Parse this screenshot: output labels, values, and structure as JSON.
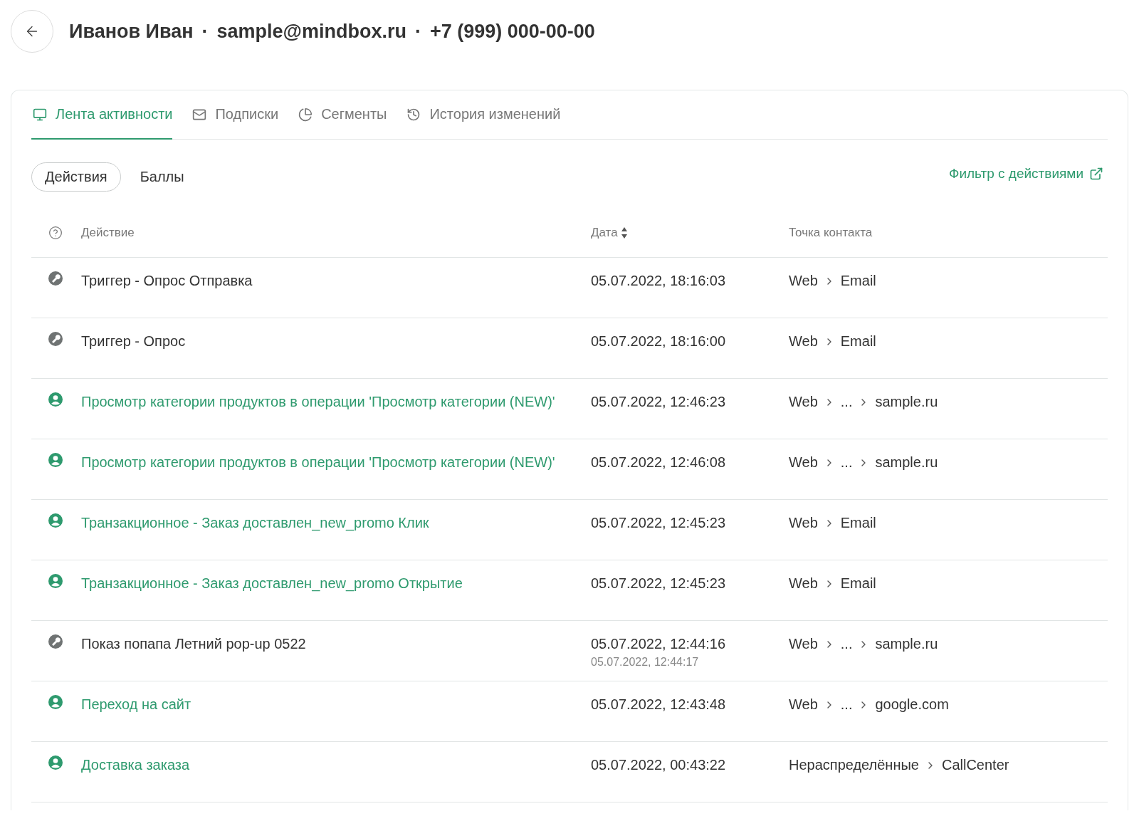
{
  "header": {
    "name": "Иванов Иван",
    "separator_1": "·",
    "email": "sample@mindbox.ru",
    "separator_2": "·",
    "phone": "+7 (999) 000-00-00"
  },
  "tabs": [
    {
      "label": "Лента активности",
      "kind": "feed",
      "selected": true
    },
    {
      "label": "Подписки",
      "kind": "mail",
      "selected": false
    },
    {
      "label": "Сегменты",
      "kind": "pie",
      "selected": false
    },
    {
      "label": "История изменений",
      "kind": "history",
      "selected": false
    }
  ],
  "switcher": [
    {
      "label": "Действия",
      "selected": true
    },
    {
      "label": "Баллы",
      "selected": false
    }
  ],
  "filter_link": "Фильтр с действиями",
  "table": {
    "columns": [
      "Действие",
      "Дата",
      "Точка контакта"
    ],
    "rows": [
      {
        "kind": "system",
        "action": "Триггер - Опрос Отправка",
        "date": "05.07.2022, 18:16:03",
        "contact": [
          "Web",
          "Email"
        ]
      },
      {
        "kind": "system",
        "action": "Триггер - Опрос",
        "date": "05.07.2022, 18:16:00",
        "contact": [
          "Web",
          "Email"
        ]
      },
      {
        "kind": "customer",
        "action": "Просмотр категории продуктов в операции 'Просмотр категории (NEW)'",
        "date": "05.07.2022, 12:46:23",
        "contact": [
          "Web",
          "...",
          "sample.ru"
        ]
      },
      {
        "kind": "customer",
        "action": "Просмотр категории продуктов в операции 'Просмотр категории (NEW)'",
        "date": "05.07.2022, 12:46:08",
        "contact": [
          "Web",
          "...",
          "sample.ru"
        ]
      },
      {
        "kind": "customer",
        "action": "Транзакционное - Заказ доставлен_new_promo Клик",
        "date": "05.07.2022, 12:45:23",
        "contact": [
          "Web",
          "Email"
        ]
      },
      {
        "kind": "customer",
        "action": "Транзакционное - Заказ доставлен_new_promo Открытие",
        "date": "05.07.2022, 12:45:23",
        "contact": [
          "Web",
          "Email"
        ]
      },
      {
        "kind": "system",
        "action": "Показ попапа Летний pop-up 0522",
        "date": "05.07.2022, 12:44:16",
        "date_secondary": "05.07.2022, 12:44:17",
        "contact": [
          "Web",
          "...",
          "sample.ru"
        ]
      },
      {
        "kind": "customer",
        "action": "Переход на сайт",
        "date": "05.07.2022, 12:43:48",
        "contact": [
          "Web",
          "...",
          "google.com"
        ]
      },
      {
        "kind": "customer",
        "action": "Доставка заказа",
        "date": "05.07.2022, 00:43:22",
        "contact": [
          "Нераспределённые",
          "CallCenter"
        ]
      }
    ]
  }
}
